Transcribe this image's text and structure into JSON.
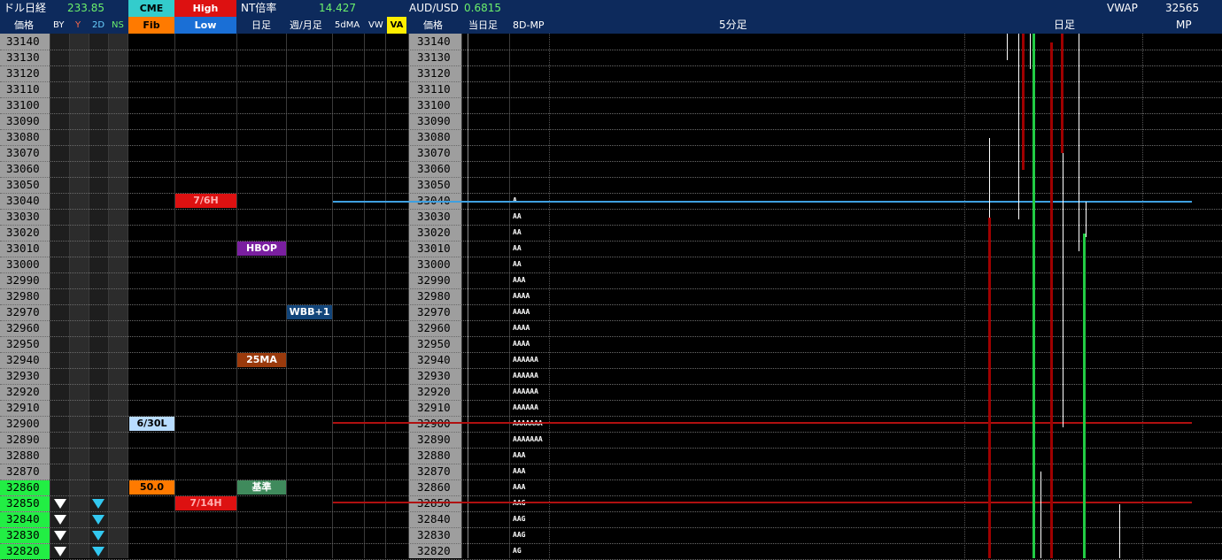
{
  "header": {
    "usdjpy_label": "ドル日経",
    "usdjpy_value": "233.85",
    "cme_label": "CME",
    "high_label": "High",
    "nt_label": "NT倍率",
    "nt_value": "14.427",
    "aud_label": "AUD/USD",
    "aud_value": "0.6815",
    "vwap_label": "VWAP",
    "vwap_value": "32565",
    "price_label": "価格",
    "by_label": "BY",
    "y_label": "Y",
    "d2_label": "2D",
    "ns_label": "NS",
    "fib_label": "Fib",
    "low_label": "Low",
    "daily_label": "日足",
    "weekly_label": "週/月足",
    "ma5_label": "5dMA",
    "vw_label": "VW",
    "va_label": "VA",
    "price_label2": "価格",
    "today_label": "当日足",
    "mp8d_label": "8D-MP",
    "min5_label": "5分足",
    "daily_label2": "日足",
    "mp_label": "MP"
  },
  "prices": [
    "33140",
    "33130",
    "33120",
    "33110",
    "33100",
    "33090",
    "33080",
    "33070",
    "33060",
    "33050",
    "33040",
    "33030",
    "33020",
    "33010",
    "33000",
    "32990",
    "32980",
    "32970",
    "32960",
    "32950",
    "32940",
    "32930",
    "32920",
    "32910",
    "32900",
    "32890",
    "32880",
    "32870",
    "32860",
    "32850",
    "32840",
    "32830",
    "32820"
  ],
  "highlight_prices": [
    "32860",
    "32850",
    "32840",
    "32830",
    "32820"
  ],
  "tags": {
    "t_7_6h": "7/6H",
    "hbop": "HBOP",
    "wbb1": "WBB+1",
    "ma25": "25MA",
    "d630l": "6/30L",
    "fib50": "50.0",
    "kijun": "基準",
    "t_7_14h": "7/14H"
  },
  "market_profile": [
    "",
    "",
    "",
    "",
    "",
    "",
    "",
    "",
    "",
    "",
    "A",
    "AA",
    "AA",
    "AA",
    "AA",
    "AAA",
    "AAAA",
    "AAAA",
    "AAAA",
    "AAAA",
    "AAAAAA",
    "AAAAAA",
    "AAAAAA",
    "AAAAAA",
    "AAAAAAA",
    "AAAAAAA",
    "AAA",
    "AAA",
    "AAA",
    "AAG",
    "AAG",
    "AAG",
    "AG"
  ],
  "colors": {
    "header_bg": "#0d2a5c",
    "price_col": "#9e9e9e",
    "highlight_green": "#22ee44",
    "cme_cyan": "#33cccc",
    "high_red": "#dd1111",
    "fib_orange": "#ff7a00",
    "low_blue": "#1a6fd6",
    "va_yellow": "#ffee00",
    "tag_red": "#dd1111",
    "tag_purple": "#7a1fa0",
    "tag_navy": "#12457a",
    "tag_brown": "#9a3a0c",
    "tag_lightblue": "#b8dcff",
    "tag_green": "#3f8a5c",
    "line_blue": "#3fa0e0",
    "line_red": "#b01010",
    "candle_red": "#a00000",
    "candle_green": "#22cc44"
  }
}
